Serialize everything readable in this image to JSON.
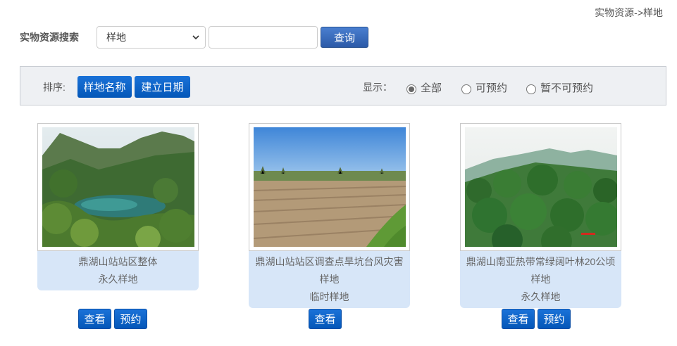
{
  "breadcrumb": "实物资源->样地",
  "search": {
    "label": "实物资源搜索",
    "selected": "样地",
    "input_value": "",
    "button": "查询"
  },
  "toolbar": {
    "sort_label": "排序:",
    "sort_name": "样地名称",
    "sort_date": "建立日期",
    "show_label": "显示：",
    "radio_all": "全部",
    "radio_available": "可预约",
    "radio_unavailable": "暂不可预约",
    "radio_selected": "全部"
  },
  "cards": [
    {
      "title": "鼎湖山站站区整体",
      "type": "永久样地",
      "view": "查看",
      "reserve": "预约"
    },
    {
      "title": "鼎湖山站站区调查点旱坑台风灾害",
      "title_line2": "样地",
      "type": "临时样地",
      "view": "查看"
    },
    {
      "title": "鼎湖山南亚热带常绿阔叶林20公顷",
      "title_line2": "样地",
      "type": "永久样地",
      "view": "查看",
      "reserve": "预约"
    }
  ],
  "colors": {
    "accent_button": "#0a62c9",
    "search_button": "#3a6dbf",
    "card_info_bg": "#d7e6f8",
    "toolbar_bg": "#eef0f3"
  }
}
